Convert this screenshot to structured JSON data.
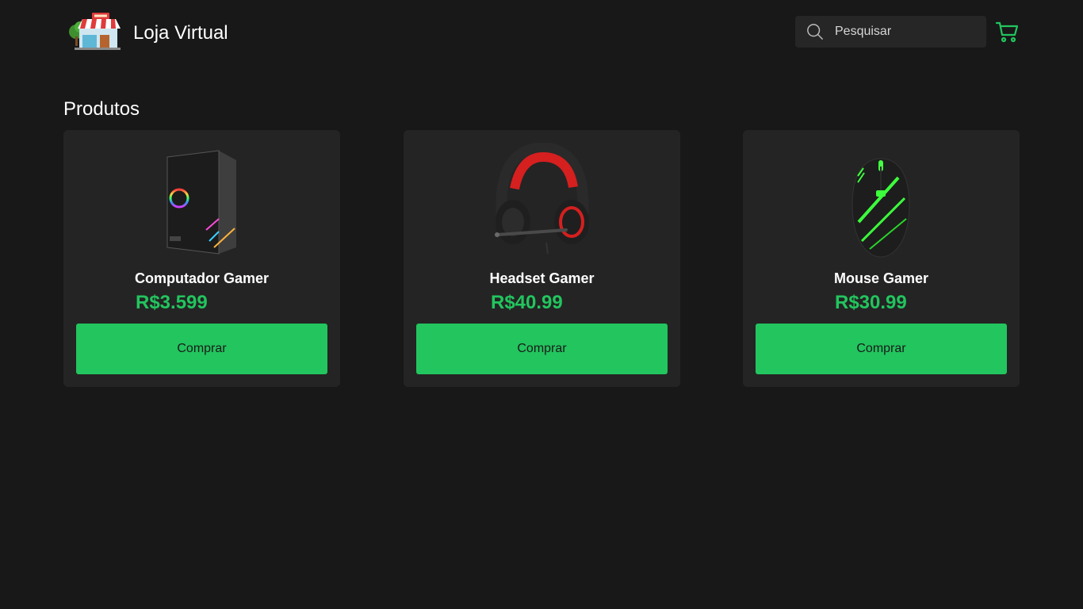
{
  "header": {
    "brand": "Loja Virtual",
    "search": {
      "placeholder": "Pesquisar",
      "value": ""
    },
    "logo_icon": "shop-storefront-icon",
    "cart_icon": "shopping-cart-icon"
  },
  "products_section": {
    "title": "Produtos",
    "items": [
      {
        "name": "Computador Gamer",
        "price": "R$3.599",
        "buy_label": "Comprar",
        "image": "pc-case-icon"
      },
      {
        "name": "Headset Gamer",
        "price": "R$40.99",
        "buy_label": "Comprar",
        "image": "headset-icon"
      },
      {
        "name": "Mouse Gamer",
        "price": "R$30.99",
        "buy_label": "Comprar",
        "image": "mouse-icon"
      }
    ]
  },
  "colors": {
    "background": "#181818",
    "card": "#242424",
    "accent": "#22c55e",
    "search_bg": "#262626"
  }
}
